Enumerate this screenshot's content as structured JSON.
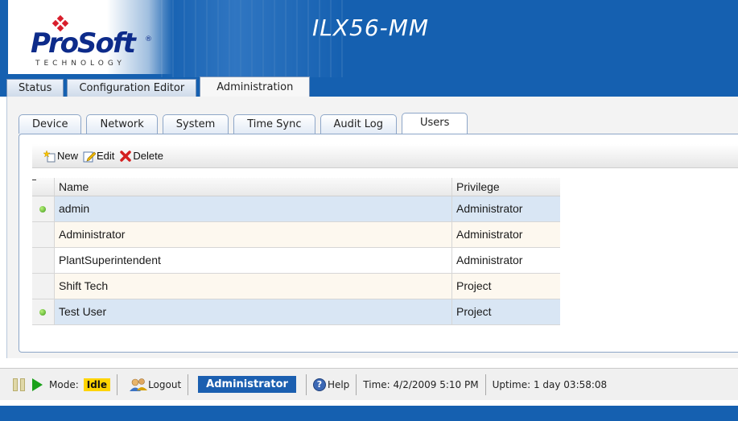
{
  "header": {
    "logo_text": "ProSoft",
    "logo_sub": "TECHNOLOGY",
    "product": "ILX56-MM"
  },
  "main_tabs": [
    {
      "label": "Status",
      "active": false
    },
    {
      "label": "Configuration Editor",
      "active": false
    },
    {
      "label": "Administration",
      "active": true
    }
  ],
  "sub_tabs": [
    {
      "label": "Device",
      "active": false
    },
    {
      "label": "Network",
      "active": false
    },
    {
      "label": "System",
      "active": false
    },
    {
      "label": "Time Sync",
      "active": false
    },
    {
      "label": "Audit Log",
      "active": false
    },
    {
      "label": "Users",
      "active": true
    }
  ],
  "toolbar": {
    "new_label": "New",
    "edit_label": "Edit",
    "delete_label": "Delete"
  },
  "grid": {
    "col_name": "Name",
    "col_privilege": "Privilege",
    "rows": [
      {
        "name": "admin",
        "privilege": "Administrator",
        "online": true,
        "selected": true
      },
      {
        "name": "Administrator",
        "privilege": "Administrator",
        "online": false,
        "selected": false
      },
      {
        "name": "PlantSuperintendent",
        "privilege": "Administrator",
        "online": false,
        "selected": false
      },
      {
        "name": "Shift Tech",
        "privilege": "Project",
        "online": false,
        "selected": false
      },
      {
        "name": "Test User",
        "privilege": "Project",
        "online": true,
        "selected": true
      }
    ]
  },
  "statusbar": {
    "mode_label": "Mode:",
    "mode_value": "Idle",
    "logout_label": "Logout",
    "user_role": "Administrator",
    "help_label": "Help",
    "time_text": "Time: 4/2/2009 5:10 PM",
    "uptime_text": "Uptime: 1 day 03:58:08"
  },
  "colors": {
    "header_blue": "#1560b0",
    "online_green": "#3f9a1a",
    "mode_idle": "#ffd400"
  }
}
